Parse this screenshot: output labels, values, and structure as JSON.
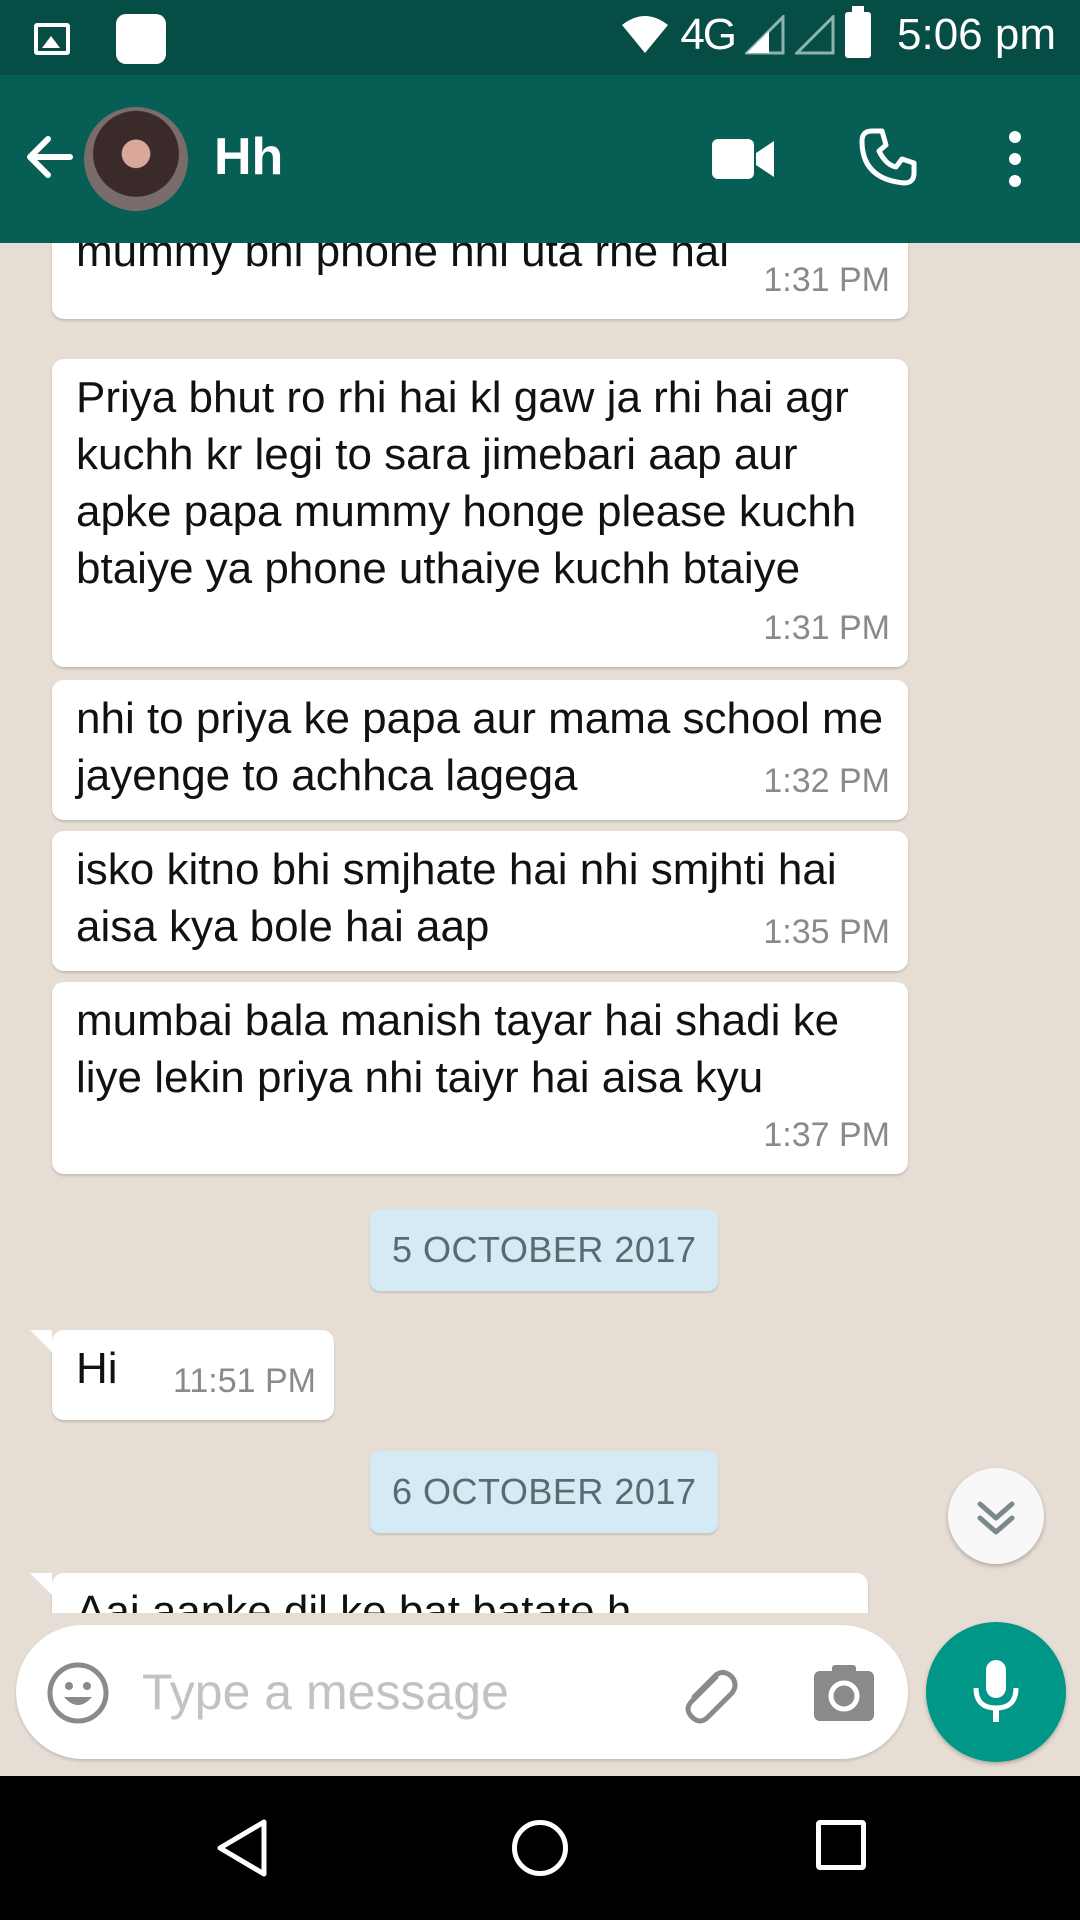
{
  "status_bar": {
    "network": "4G",
    "time": "5:06 pm"
  },
  "header": {
    "contact_name": "Hh"
  },
  "messages": [
    {
      "text": "mummy bhi phone nhi uta rhe hai",
      "time": "1:31 PM"
    },
    {
      "text": "Priya bhut ro rhi hai kl gaw ja rhi hai agr kuchh kr legi to sara jimebari aap aur apke papa mummy honge please kuchh btaiye ya phone uthaiye kuchh btaiye",
      "time": "1:31 PM"
    },
    {
      "text": "nhi to priya ke papa aur mama school me jayenge to achhca lagega",
      "time": "1:32 PM"
    },
    {
      "text": "isko kitno bhi smjhate hai nhi smjhti hai aisa kya bole hai aap",
      "time": "1:35 PM"
    },
    {
      "text": "mumbai bala manish tayar hai shadi ke liye lekin priya nhi taiyr hai aisa kyu",
      "time": "1:37 PM"
    },
    {
      "text": "Hi",
      "time": "11:51 PM"
    },
    {
      "text": "Aaj aapke dil ke bat batate h",
      "time": ""
    }
  ],
  "date_chips": [
    "5 OCTOBER 2017",
    "6 OCTOBER 2017"
  ],
  "composer": {
    "placeholder": "Type a message"
  },
  "colors": {
    "header": "#075e54",
    "status_bar": "#064d45",
    "chat_background": "#e6ded4",
    "mic_button": "#009688",
    "date_chip": "#d4eaf4"
  }
}
